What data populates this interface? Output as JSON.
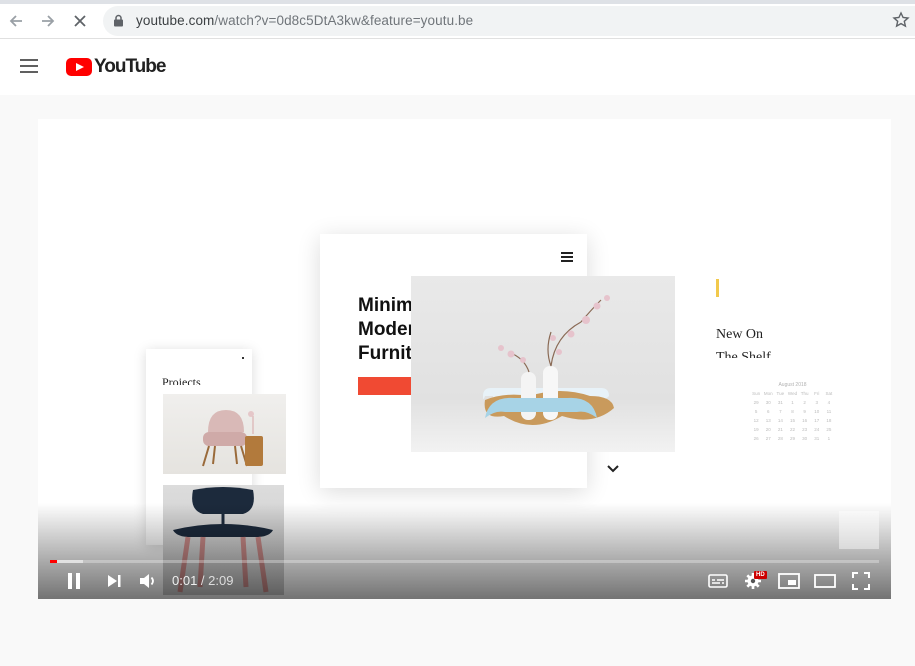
{
  "browser": {
    "url_domain": "youtube.com",
    "url_path": "/watch?v=0d8c5DtA3kw&feature=youtu.be"
  },
  "youtube": {
    "logo_text": "YouTube"
  },
  "video": {
    "headline_line1": "Minimal &",
    "headline_line2": "Modern",
    "headline_line3": "Furniture.",
    "side_text_line1": "New On",
    "side_text_line2": "The Shelf",
    "left_card_title": "Projects",
    "calendar_title": "August 2018",
    "calendar_days": [
      "Sun",
      "Mon",
      "Tue",
      "Wed",
      "Thu",
      "Fri",
      "Sat"
    ],
    "calendar_numbers": [
      "29",
      "30",
      "31",
      "1",
      "2",
      "3",
      "4",
      "5",
      "6",
      "7",
      "8",
      "9",
      "10",
      "11",
      "12",
      "13",
      "14",
      "15",
      "16",
      "17",
      "18",
      "19",
      "20",
      "21",
      "22",
      "23",
      "24",
      "25",
      "26",
      "27",
      "28",
      "29",
      "30",
      "31",
      "1"
    ]
  },
  "player": {
    "current_time": "0:01",
    "duration": "2:09",
    "time_separator": " / ",
    "played_fraction": 0.008,
    "buffered_fraction": 0.04,
    "hd_label": "HD",
    "accent_color": "#ff0000"
  }
}
